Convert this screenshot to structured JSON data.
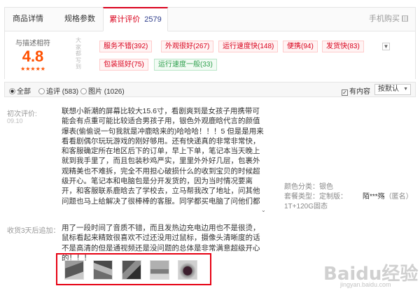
{
  "tabs": {
    "details": "商品详情",
    "specs": "规格参数",
    "reviews": "累计评价",
    "reviews_count": "2579",
    "mobile_buy": "手机购买"
  },
  "summary": {
    "label": "与描述相符",
    "score": "4.8",
    "stars": "★★★★★",
    "vertical_label": "大家都写到",
    "tags": [
      {
        "text": "服务不错(392)",
        "tone": "good_red"
      },
      {
        "text": "外观很好(267)",
        "tone": "good_red"
      },
      {
        "text": "运行速度快(148)",
        "tone": "good_red"
      },
      {
        "text": "便携(94)",
        "tone": "good_red"
      },
      {
        "text": "发货快(83)",
        "tone": "good_red"
      },
      {
        "text": "包装挺好(75)",
        "tone": "good_red"
      },
      {
        "text": "运行速度一般(33)",
        "tone": "neutral_green"
      }
    ],
    "expand_icon": "chevron-down-icon"
  },
  "filter": {
    "all": "全部",
    "append": "追评 (583)",
    "photo": "图片 (1026)",
    "has_content": "有内容",
    "sort": "按默认"
  },
  "review": {
    "initial_label": "初次评价:",
    "initial_date": "09.10",
    "text": "联想小新潮的屏幕比较大15.6寸，看剧爽到是女孩子用携带可能会有点重可能比较适合男孩子用，银色外观鹿晗代言的颜值爆表(偷偷说一句我就是冲鹿晗来的)哈哈哈！！！5 但是是用来看看剧偶尔玩玩游戏的刚好够用。还有快递真的非常非常快，和客服确定所在地区后下的订单，早上下单，笔记本当天晚上就到我手里了，而且包装秒鸡严实，里里外外好几层，包裹外观精美也不难拆，完全不用担心破损什么的收到宝贝的时候超级开心。笔记本和电脑包是分开发货的，因为当时情况要离开，和客服联系鹿晗去了学校去，立马帮我改了地址，问其他问题也马上给解决了很棒棒的客服。同学都买电脑了问他们都说买的联想，然后我就瞄准了联想，一看还有我男神代言，简直开心的要死，而且全国联保也不担心出问题，上网也好，商务办公也很方便",
    "fold_icon": "chevron-down-icon",
    "color_label": "颜色分类：",
    "color_value": "银色",
    "package_label": "套餐类型：",
    "package_value": "定制版：",
    "package_value2": "1T+120G固态",
    "user": "陌***殇",
    "anon": "（匿名）",
    "followup_label": "收货3天后追加：",
    "followup_text": "用了一段时间了音质不错，而且发热边充电边用也不是很烫，鼠标看起来精致很喜欢不过还没用过鼠标，摄像头清晰度的话不是高清的但是通视频还是没问题的总体是非常满意超级开心的！！！",
    "photos": [
      "photo-1",
      "photo-2",
      "photo-3",
      "photo-4",
      "photo-5"
    ]
  },
  "watermark": {
    "text": "Baidu经验",
    "sub": "jingyan.baidu.com"
  }
}
